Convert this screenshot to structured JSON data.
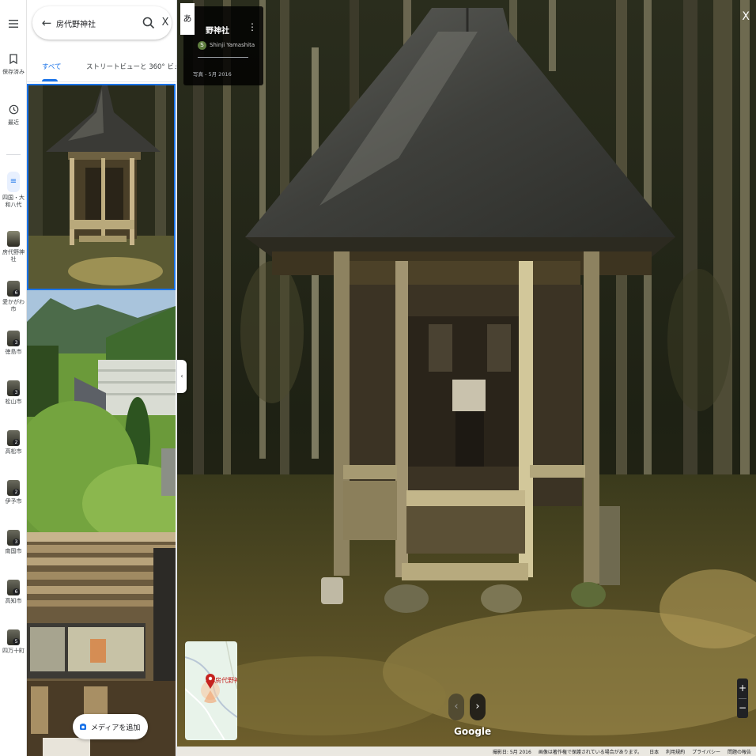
{
  "rail": {
    "menu_icon": "hamburger-icon",
    "saved_label": "保存済み",
    "recent_label": "最近",
    "places": [
      {
        "label": "四国・大和八代",
        "badge": ""
      },
      {
        "label": "房代野神社",
        "badge": ""
      },
      {
        "label": "愛かがわ市",
        "badge": "6"
      },
      {
        "label": "徳島市",
        "badge": "3"
      },
      {
        "label": "松山市",
        "badge": "3"
      },
      {
        "label": "高松市",
        "badge": "2"
      },
      {
        "label": "伊予市",
        "badge": "2"
      },
      {
        "label": "南国市",
        "badge": "3"
      },
      {
        "label": "高知市",
        "badge": "6"
      },
      {
        "label": "四万十町",
        "badge": "5"
      }
    ]
  },
  "panel": {
    "search_value": "房代野神社",
    "tabs": [
      {
        "label": "すべて",
        "active": true
      },
      {
        "label": "ストリートビューと 360° ビュー",
        "active": false
      }
    ],
    "add_media_label": "メディアを追加"
  },
  "viewer": {
    "lang_button": "あ",
    "title": "野神社",
    "author_initial": "S",
    "author": "Shinji Yamashita",
    "date": "写真 - 5月 2016",
    "minimap_label": "房代野神",
    "close_label": "X",
    "logo": "Google",
    "zoom_in": "+",
    "zoom_out": "−",
    "footer": {
      "capture": "撮影日: 5月 2016",
      "copyright": "画像は著作権で保護されている場合があります。",
      "country": "日本",
      "terms": "利用規約",
      "privacy": "プライバシー",
      "report": "問題の報告"
    }
  },
  "colors": {
    "accent": "#1a73e8",
    "pin": "#c5221f"
  }
}
